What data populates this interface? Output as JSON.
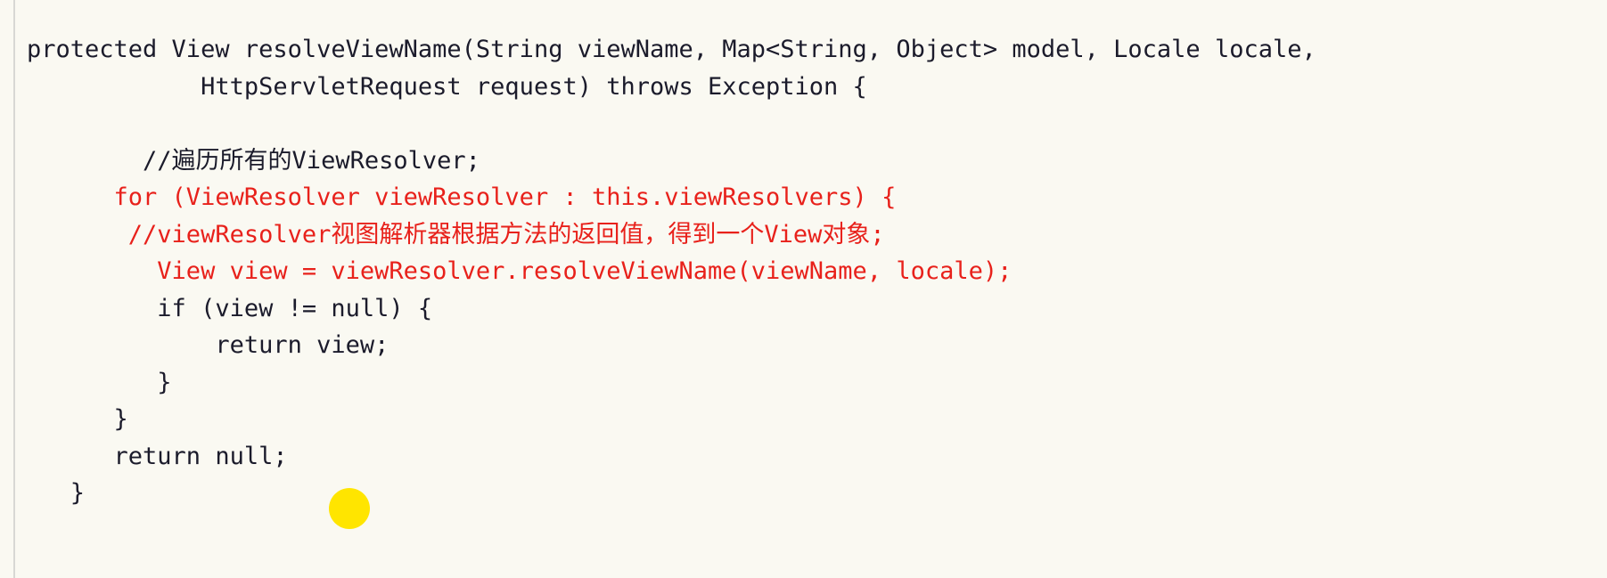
{
  "code_block": {
    "language": "java",
    "background_color": "#faf9f2",
    "default_text_color": "#1b1b2b",
    "highlight_text_color": "#e8211b",
    "highlight_dot_color": "#ffe500",
    "lines": [
      {
        "indent": "",
        "text": "protected View resolveViewName(String viewName, Map<String, Object> model, Locale locale,",
        "color": "plain"
      },
      {
        "indent": "",
        "text": "            HttpServletRequest request) throws Exception {",
        "color": "plain"
      },
      {
        "indent": "",
        "text": "",
        "color": "plain"
      },
      {
        "indent": "",
        "text": "        //遍历所有的ViewResolver;",
        "color": "plain"
      },
      {
        "indent": "",
        "text": "      for (ViewResolver viewResolver : this.viewResolvers) {",
        "color": "red"
      },
      {
        "indent": "",
        "text": "       //viewResolver视图解析器根据方法的返回值，得到一个View对象;",
        "color": "red"
      },
      {
        "indent": "",
        "text": "         View view = viewResolver.resolveViewName(viewName, locale);",
        "color": "red"
      },
      {
        "indent": "",
        "text": "         if (view != null) {",
        "color": "plain"
      },
      {
        "indent": "",
        "text": "             return view;",
        "color": "plain"
      },
      {
        "indent": "",
        "text": "         }",
        "color": "plain"
      },
      {
        "indent": "",
        "text": "      }",
        "color": "plain"
      },
      {
        "indent": "",
        "text": "      return null;",
        "color": "plain"
      },
      {
        "indent": "",
        "text": "   }",
        "color": "plain"
      }
    ]
  }
}
